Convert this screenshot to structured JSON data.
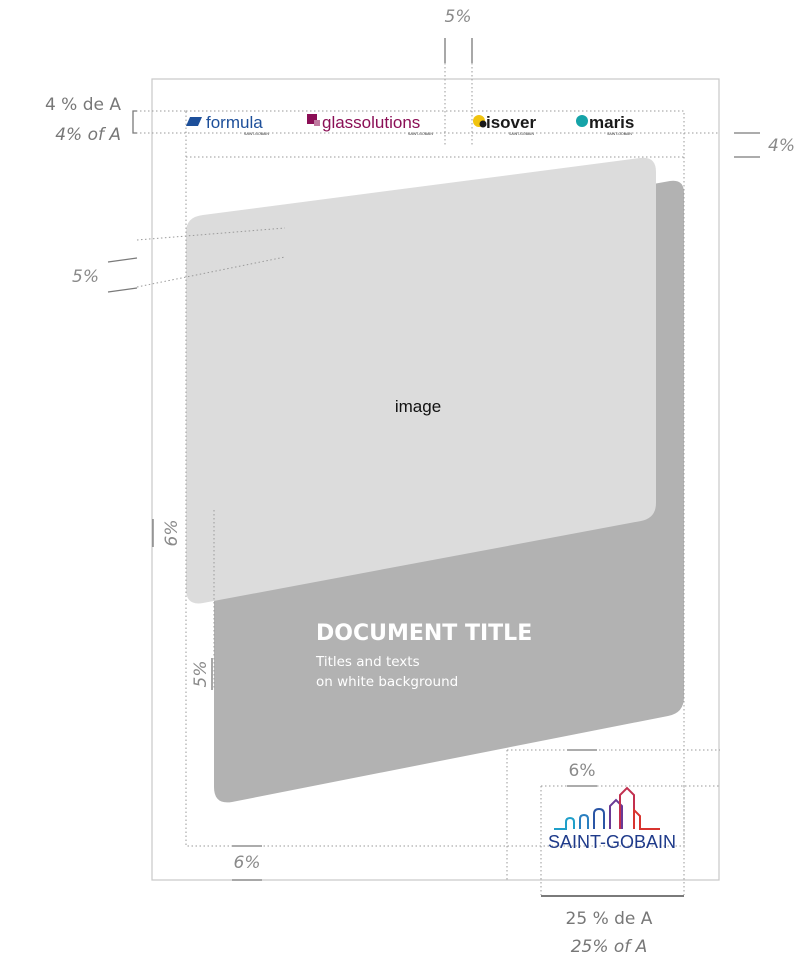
{
  "annotations": {
    "top_gap": "5%",
    "header_fr": "4 % de A",
    "header_en": "4% of A",
    "right_gap": "4%",
    "left_slant_gap": "5%",
    "left_margin_a": "6%",
    "left_margin_b": "5%",
    "bottom_margin": "6%",
    "logo_gap": "6%",
    "logo_width_fr": "25 % de A",
    "logo_width_en": "25% of A"
  },
  "brands": [
    {
      "name": "formula",
      "sub": "SAINT-GOBAIN",
      "color": "#1d4f9a",
      "mark_color": "#1d4f9a"
    },
    {
      "name": "glassolutions",
      "sub": "SAINT-GOBAIN",
      "color": "#8b0f56",
      "mark_color": "#8b0f56"
    },
    {
      "name": "isover",
      "sub": "SAINT-GOBAIN",
      "color": "#1a1a1a",
      "mark_color": "#f1c40f"
    },
    {
      "name": "maris",
      "sub": "SAINT-GOBAIN",
      "color": "#1a1a1a",
      "mark_color": "#15a3a8"
    }
  ],
  "image_label": "image",
  "document": {
    "title": "DOCUMENT TITLE",
    "subtitle_line1": "Titles and texts",
    "subtitle_line2": "on white background"
  },
  "logo": {
    "text": "SAINT-GOBAIN",
    "text_color": "#1e3a8a",
    "line_colors": [
      "#1f9fc9",
      "#2a55a5",
      "#8a3a8a",
      "#d8342f"
    ]
  },
  "colors": {
    "image_panel": "#dcdcdc",
    "title_panel": "#b2b2b2",
    "guides": "#9a9a9a",
    "page_border": "#c8c8c8"
  }
}
